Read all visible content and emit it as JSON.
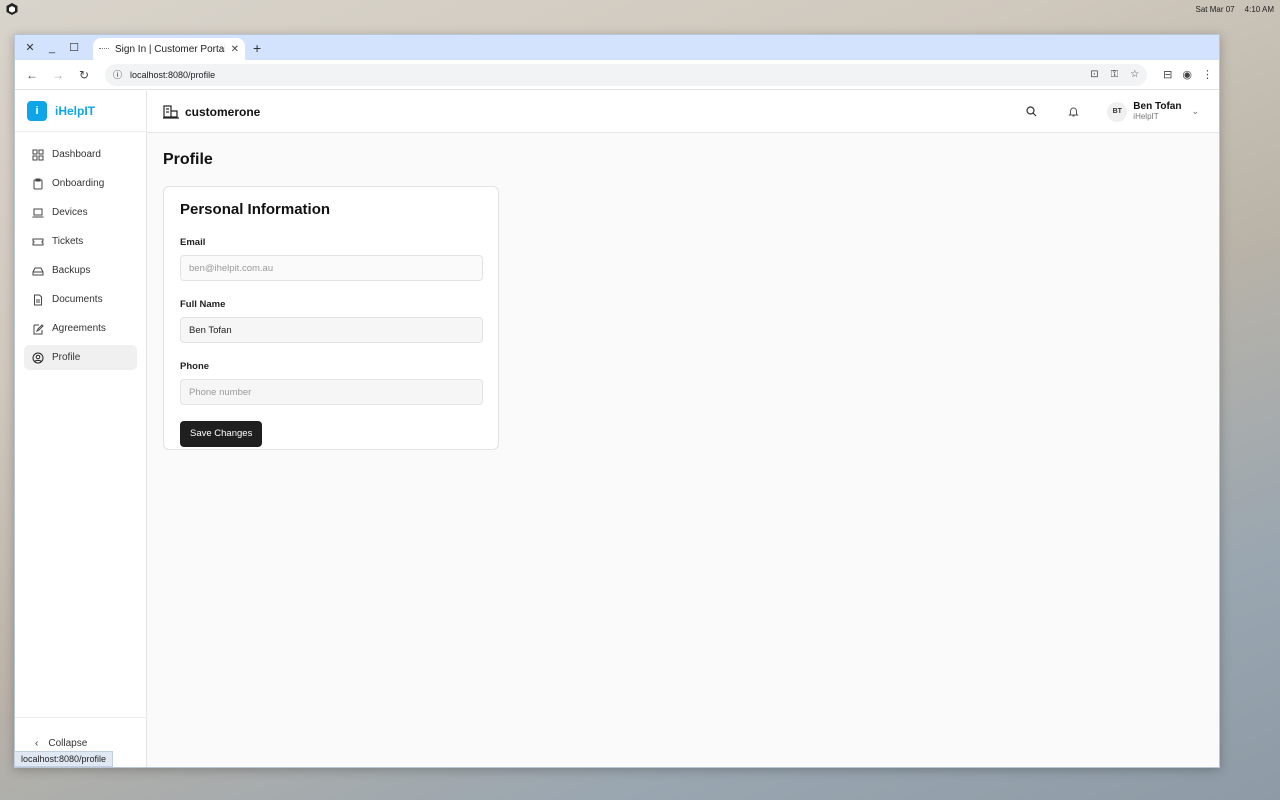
{
  "os": {
    "date": "Sat Mar 07",
    "time": "4:10 AM"
  },
  "browser": {
    "tab_title": "Sign In | Customer Portal",
    "url": "localhost:8080/profile",
    "status_url": "localhost:8080/profile"
  },
  "app": {
    "brand_letter": "i",
    "brand_name": "iHelpIT",
    "org_name": "customerone",
    "accent": "#0ea5e9"
  },
  "sidebar": {
    "items": [
      {
        "label": "Dashboard",
        "icon": "dashboard-icon"
      },
      {
        "label": "Onboarding",
        "icon": "clipboard-icon"
      },
      {
        "label": "Devices",
        "icon": "laptop-icon"
      },
      {
        "label": "Tickets",
        "icon": "ticket-icon"
      },
      {
        "label": "Backups",
        "icon": "hard-drive-icon"
      },
      {
        "label": "Documents",
        "icon": "document-icon"
      },
      {
        "label": "Agreements",
        "icon": "pen-document-icon"
      },
      {
        "label": "Profile",
        "icon": "user-circle-icon",
        "active": true
      }
    ],
    "collapse_label": "Collapse"
  },
  "user": {
    "initials": "BT",
    "name": "Ben Tofan",
    "org": "iHelpIT"
  },
  "main": {
    "title": "Profile",
    "card_title": "Personal Information",
    "email_label": "Email",
    "email_value": "ben@ihelpit.com.au",
    "fullname_label": "Full Name",
    "fullname_value": "Ben Tofan",
    "phone_label": "Phone",
    "phone_placeholder": "Phone number",
    "save_label": "Save Changes"
  }
}
